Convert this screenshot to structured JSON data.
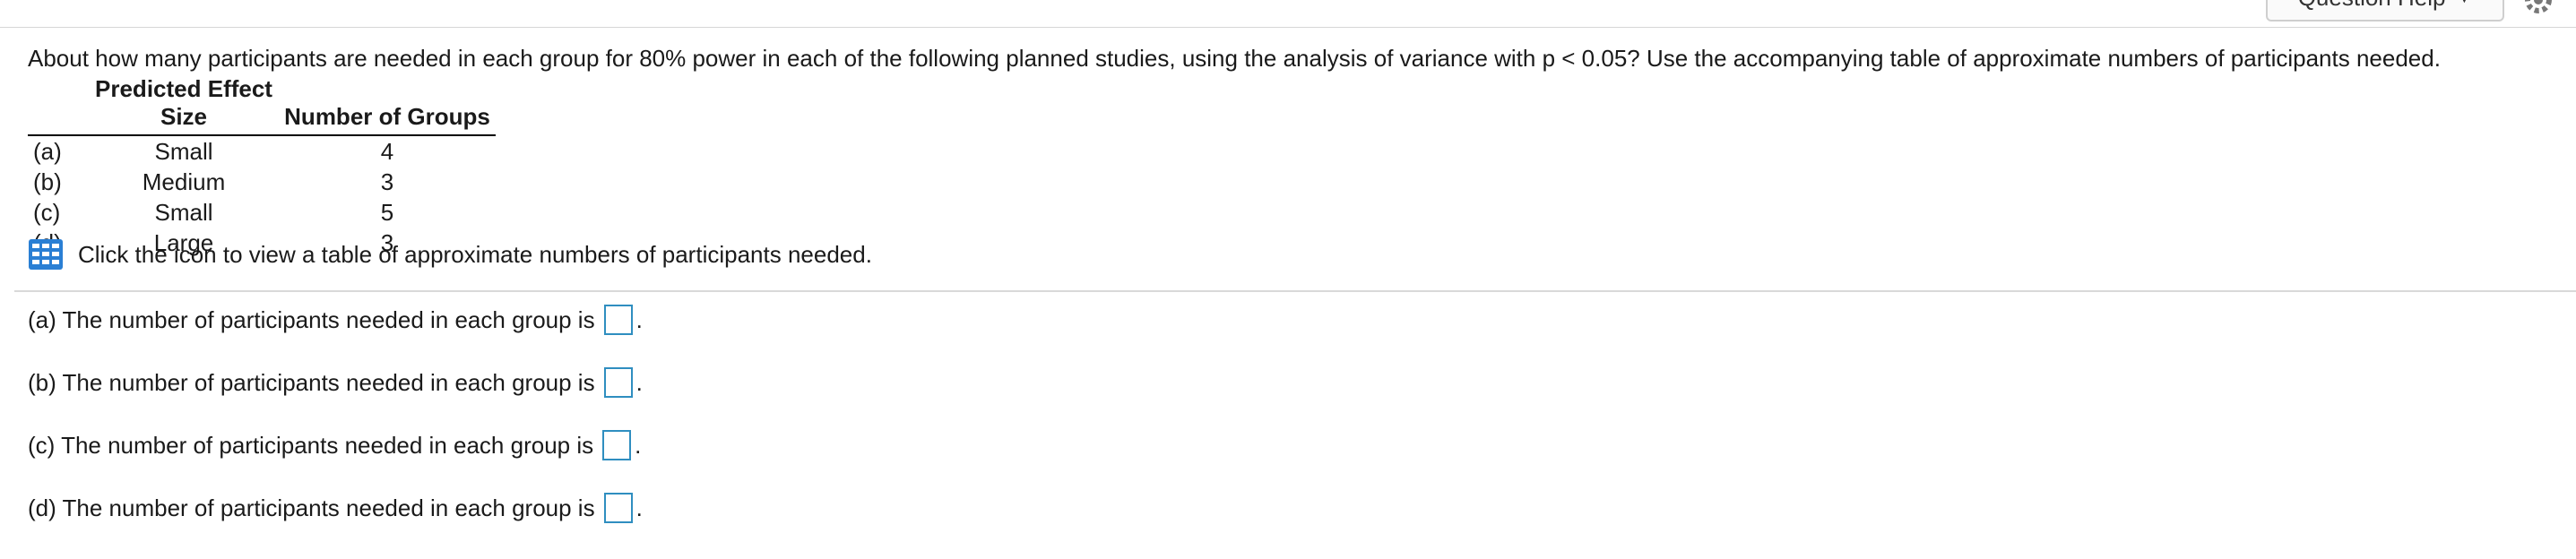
{
  "header": {
    "help_button_label": "Question Help",
    "help_caret": "▼",
    "settings_icon": "gear-icon"
  },
  "question": {
    "text": "About how many participants are needed in each group for 80% power in each of the following planned studies, using the analysis of variance with p < 0.05? Use the accompanying table of approximate numbers of participants needed."
  },
  "table": {
    "headers": [
      "",
      "Predicted Effect Size",
      "Number of Groups"
    ],
    "rows": [
      {
        "label": "(a)",
        "effect": "Small",
        "groups": "4"
      },
      {
        "label": "(b)",
        "effect": "Medium",
        "groups": "3"
      },
      {
        "label": "(c)",
        "effect": "Small",
        "groups": "5"
      },
      {
        "label": "(d)",
        "effect": "Large",
        "groups": "3"
      }
    ]
  },
  "icon_link": {
    "icon": "table-grid-icon",
    "text": "Click the icon to view a table of approximate numbers of participants needed."
  },
  "answers": [
    {
      "text": "(a) The number of participants needed in each group is",
      "value": ""
    },
    {
      "text": "(b) The number of participants needed in each group is",
      "value": ""
    },
    {
      "text": "(c) The number of participants needed in each group is",
      "value": ""
    },
    {
      "text": "(d) The number of participants needed in each group is",
      "value": ""
    }
  ],
  "colors": {
    "input_border": "#2f8ec0",
    "icon_blue": "#2a7fd4"
  }
}
